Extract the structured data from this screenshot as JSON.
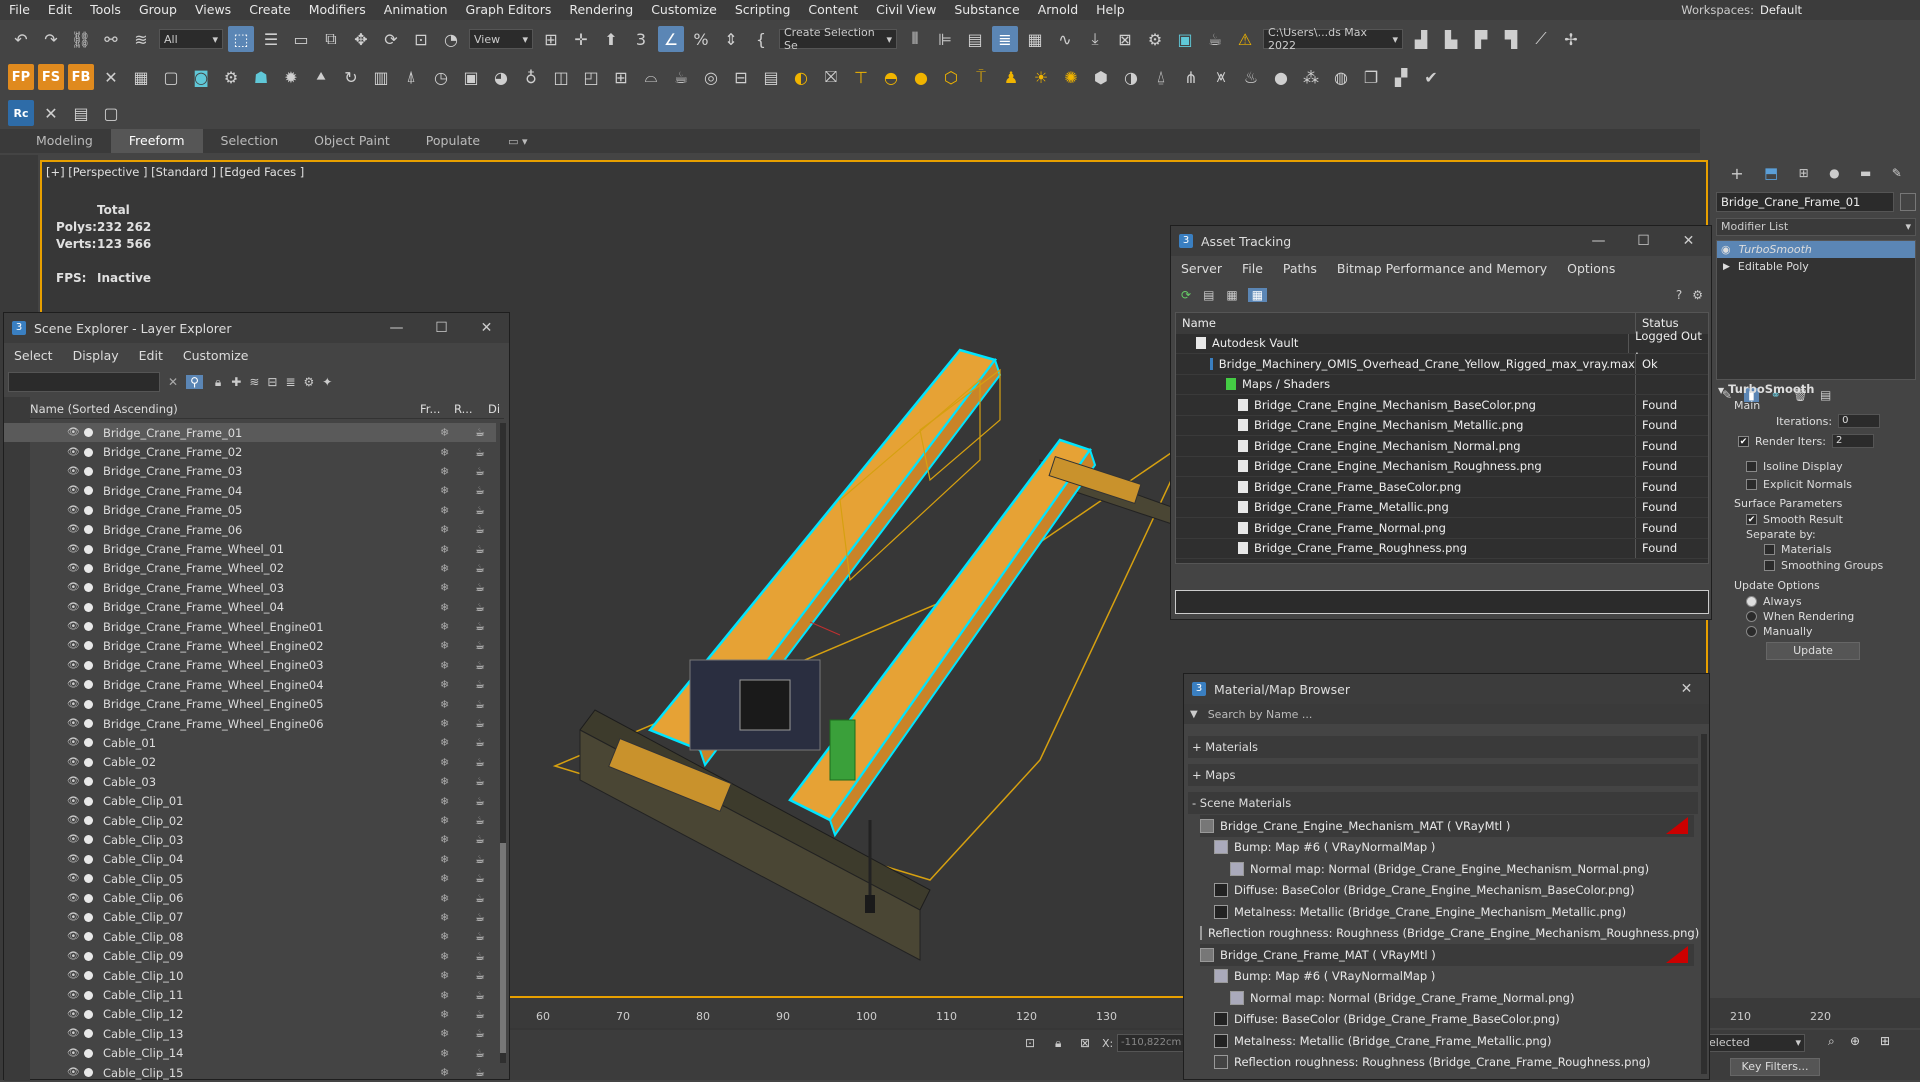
{
  "menu": [
    "File",
    "Edit",
    "Tools",
    "Group",
    "Views",
    "Create",
    "Modifiers",
    "Animation",
    "Graph Editors",
    "Rendering",
    "Customize",
    "Scripting",
    "Content",
    "Civil View",
    "Substance",
    "Arnold",
    "Help"
  ],
  "workspaces_label": "Workspaces:",
  "workspace_value": "Default",
  "toolbar": {
    "filter_value": "All",
    "view_value": "View",
    "selection_set": "Create Selection Se",
    "path_value": "C:\\Users\\...ds Max 2022"
  },
  "ribbon_tabs": [
    "Modeling",
    "Freeform",
    "Selection",
    "Object Paint",
    "Populate"
  ],
  "viewport": {
    "label": "[+] [Perspective ] [Standard ] [Edged Faces ]",
    "total_label": "Total",
    "polys_label": "Polys:",
    "polys_value": "232 262",
    "verts_label": "Verts:",
    "verts_value": "123 566",
    "fps_label": "FPS:",
    "fps_value": "Inactive",
    "ruler_ticks": [
      "60",
      "70",
      "80",
      "90",
      "100",
      "110",
      "120",
      "130",
      "210",
      "220"
    ],
    "x_label": "X:",
    "x_value": "-110,822cm",
    "selected_value": "elected",
    "key_filters": "Key Filters..."
  },
  "scene_explorer": {
    "title": "Scene Explorer - Layer Explorer",
    "menu": [
      "Select",
      "Display",
      "Edit",
      "Customize"
    ],
    "col_name": "Name (Sorted Ascending)",
    "col_fr": "Fr...",
    "col_r": "R...",
    "col_di": "Di",
    "rows": [
      "Bridge_Crane_Frame_01",
      "Bridge_Crane_Frame_02",
      "Bridge_Crane_Frame_03",
      "Bridge_Crane_Frame_04",
      "Bridge_Crane_Frame_05",
      "Bridge_Crane_Frame_06",
      "Bridge_Crane_Frame_Wheel_01",
      "Bridge_Crane_Frame_Wheel_02",
      "Bridge_Crane_Frame_Wheel_03",
      "Bridge_Crane_Frame_Wheel_04",
      "Bridge_Crane_Frame_Wheel_Engine01",
      "Bridge_Crane_Frame_Wheel_Engine02",
      "Bridge_Crane_Frame_Wheel_Engine03",
      "Bridge_Crane_Frame_Wheel_Engine04",
      "Bridge_Crane_Frame_Wheel_Engine05",
      "Bridge_Crane_Frame_Wheel_Engine06",
      "Cable_01",
      "Cable_02",
      "Cable_03",
      "Cable_Clip_01",
      "Cable_Clip_02",
      "Cable_Clip_03",
      "Cable_Clip_04",
      "Cable_Clip_05",
      "Cable_Clip_06",
      "Cable_Clip_07",
      "Cable_Clip_08",
      "Cable_Clip_09",
      "Cable_Clip_10",
      "Cable_Clip_11",
      "Cable_Clip_12",
      "Cable_Clip_13",
      "Cable_Clip_14",
      "Cable_Clip_15"
    ]
  },
  "asset_tracking": {
    "title": "Asset Tracking",
    "menu": [
      "Server",
      "File",
      "Paths",
      "Bitmap Performance and Memory",
      "Options"
    ],
    "col_name": "Name",
    "col_status": "Status",
    "rows": [
      {
        "name": "Autodesk Vault",
        "status": "Logged Out ."
      },
      {
        "name": "Bridge_Machinery_OMIS_Overhead_Crane_Yellow_Rigged_max_vray.max",
        "status": "Ok"
      },
      {
        "name": "Maps / Shaders",
        "status": ""
      },
      {
        "name": "Bridge_Crane_Engine_Mechanism_BaseColor.png",
        "status": "Found"
      },
      {
        "name": "Bridge_Crane_Engine_Mechanism_Metallic.png",
        "status": "Found"
      },
      {
        "name": "Bridge_Crane_Engine_Mechanism_Normal.png",
        "status": "Found"
      },
      {
        "name": "Bridge_Crane_Engine_Mechanism_Roughness.png",
        "status": "Found"
      },
      {
        "name": "Bridge_Crane_Frame_BaseColor.png",
        "status": "Found"
      },
      {
        "name": "Bridge_Crane_Frame_Metallic.png",
        "status": "Found"
      },
      {
        "name": "Bridge_Crane_Frame_Normal.png",
        "status": "Found"
      },
      {
        "name": "Bridge_Crane_Frame_Roughness.png",
        "status": "Found"
      }
    ]
  },
  "material_browser": {
    "title": "Material/Map Browser",
    "search_placeholder": "Search by Name ...",
    "groups": [
      "+ Materials",
      "+ Maps",
      "- Scene Materials"
    ],
    "rows": [
      "Bridge_Crane_Engine_Mechanism_MAT  ( VRayMtl )",
      "Bump: Map #6  ( VRayNormalMap )",
      "Normal map: Normal (Bridge_Crane_Engine_Mechanism_Normal.png)",
      "Diffuse: BaseColor (Bridge_Crane_Engine_Mechanism_BaseColor.png)",
      "Metalness: Metallic (Bridge_Crane_Engine_Mechanism_Metallic.png)",
      "Reflection roughness: Roughness (Bridge_Crane_Engine_Mechanism_Roughness.png)",
      "Bridge_Crane_Frame_MAT  ( VRayMtl )",
      "Bump: Map #6  ( VRayNormalMap )",
      "Normal map: Normal (Bridge_Crane_Frame_Normal.png)",
      "Diffuse: BaseColor (Bridge_Crane_Frame_BaseColor.png)",
      "Metalness: Metallic (Bridge_Crane_Frame_Metallic.png)",
      "Reflection roughness: Roughness (Bridge_Crane_Frame_Roughness.png)"
    ]
  },
  "command_panel": {
    "object_name": "Bridge_Crane_Frame_01",
    "modifier_list": "Modifier List",
    "stack": [
      "TurboSmooth",
      "Editable Poly"
    ],
    "rollout_title": "TurboSmooth",
    "main_label": "Main",
    "iterations_label": "Iterations:",
    "iterations_value": "0",
    "render_iters_label": "Render Iters:",
    "render_iters_value": "2",
    "isoline": "Isoline Display",
    "explicit": "Explicit Normals",
    "surface_params": "Surface Parameters",
    "smooth_result": "Smooth Result",
    "separate_by": "Separate by:",
    "materials": "Materials",
    "smoothing_groups": "Smoothing Groups",
    "update_options": "Update Options",
    "always": "Always",
    "when_rendering": "When Rendering",
    "manually": "Manually",
    "update_button": "Update"
  },
  "colors": {
    "accent": "#5b86b5",
    "selection_cyan": "#00e5ff",
    "crane_yellow": "#e8a030",
    "viewport_border": "#e8a000"
  }
}
